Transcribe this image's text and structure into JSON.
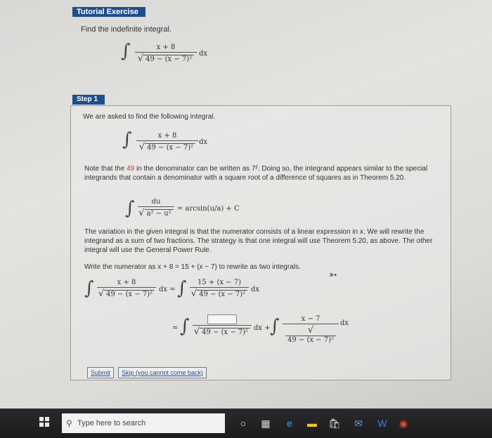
{
  "header": {
    "title": "Tutorial Exercise"
  },
  "problem": {
    "prompt": "Find the indefinite integral.",
    "numerator": "x + 8",
    "denominator": "49 − (x − 7)²",
    "dx": "dx"
  },
  "step": {
    "tab_label": "Step 1",
    "intro": "We are asked to find the following integral.",
    "note_prefix": "Note that the ",
    "note_highlight": "49",
    "note_suffix": " in the denominator can be written as 7². Doing so, the integrand appears similar to the special integrands that contain a denominator with a square root of a difference of squares as in Theorem 5.20.",
    "theorem": {
      "numerator": "du",
      "denominator": "a² − u²",
      "result": "= arcsin(u/a) + C"
    },
    "variation_text": "The variation in the given integral is that the numerator consists of a linear expression in x. We will rewrite the integrand as a sum of two fractions. The strategy is that one integral will use Theorem 5.20, as above. The other integral will use the General Power Rule.",
    "rewrite_text": "Write the numerator as x + 8 = 15 + (x − 7) to rewrite as two integrals.",
    "eq1": {
      "left_num": "x + 8",
      "right_num": "15 + (x − 7)",
      "denominator": "49 − (x − 7)²"
    },
    "eq2": {
      "second_num": "x − 7",
      "denominator": "49 − (x − 7)²"
    }
  },
  "buttons": {
    "submit": "Submit",
    "skip": "Skip (you cannot come back)"
  },
  "taskbar": {
    "search_placeholder": "Type here to search"
  }
}
